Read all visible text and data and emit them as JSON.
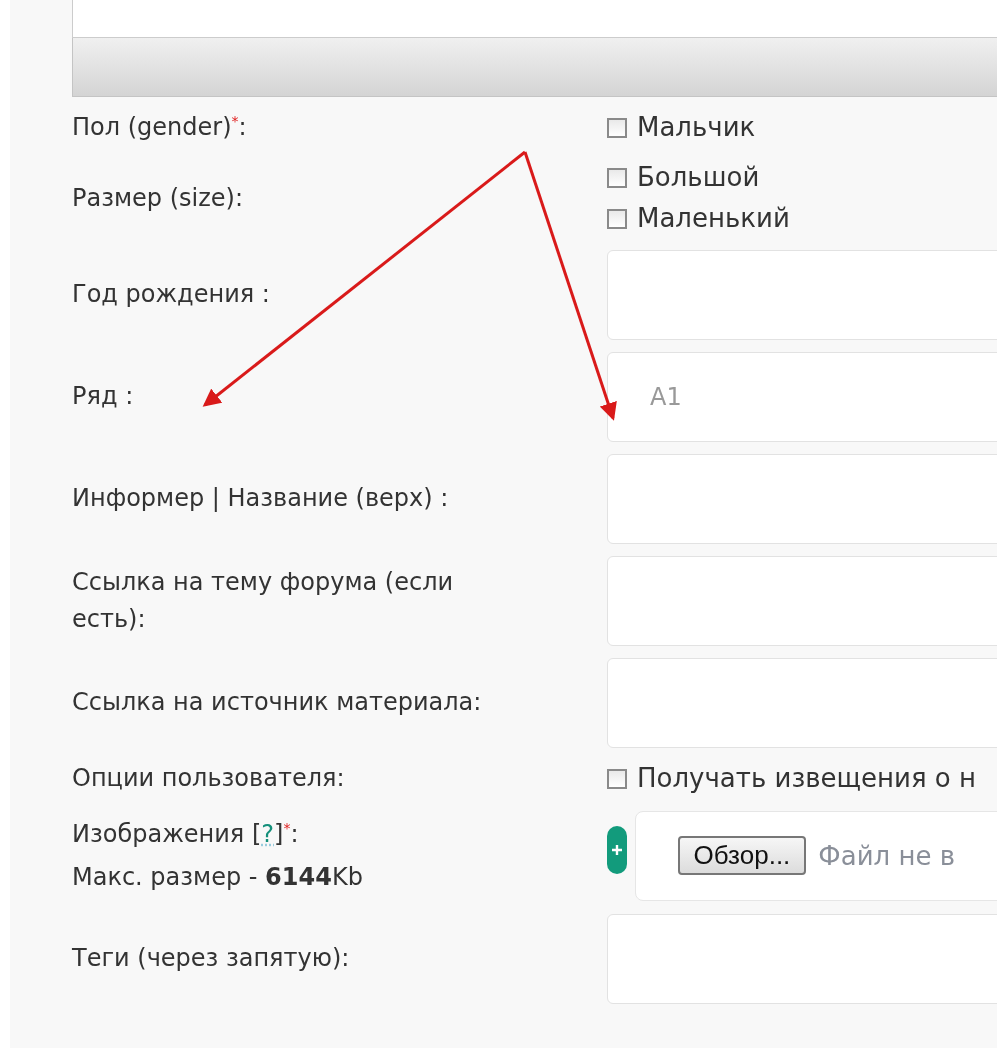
{
  "rows": [
    {
      "kind": "checkboxes",
      "label": "Пол (gender)",
      "required_mark": "*",
      "suffix": ":",
      "options": [
        {
          "label": "Мальчик",
          "checked": false
        }
      ]
    },
    {
      "kind": "checkboxes",
      "label": "Размер (size):",
      "options": [
        {
          "label": "Большой",
          "checked": false
        },
        {
          "label": "Маленький",
          "checked": false
        }
      ]
    },
    {
      "kind": "input",
      "label": "Год рождения :"
    },
    {
      "kind": "input",
      "label": "Ряд :",
      "placeholder": "A1"
    },
    {
      "kind": "input",
      "label": "Информер | Название (верх) :"
    },
    {
      "kind": "input",
      "label": "Ссылка на тему форума (если есть):"
    },
    {
      "kind": "input",
      "label": "Ссылка на источник материала:"
    },
    {
      "kind": "checkboxes",
      "label": "Опции пользователя:",
      "options": [
        {
          "label": "Получать извещения о н",
          "checked": false
        }
      ]
    },
    {
      "kind": "file",
      "label": "Изображения [",
      "help": "?",
      "label_end": "]",
      "required_mark": "*",
      "suffix": ":",
      "note": "Макс. размер - **6144**Kb",
      "button": "Обзор...",
      "status": "Файл не в"
    },
    {
      "kind": "input",
      "label": "Теги (через запятую):"
    }
  ]
}
